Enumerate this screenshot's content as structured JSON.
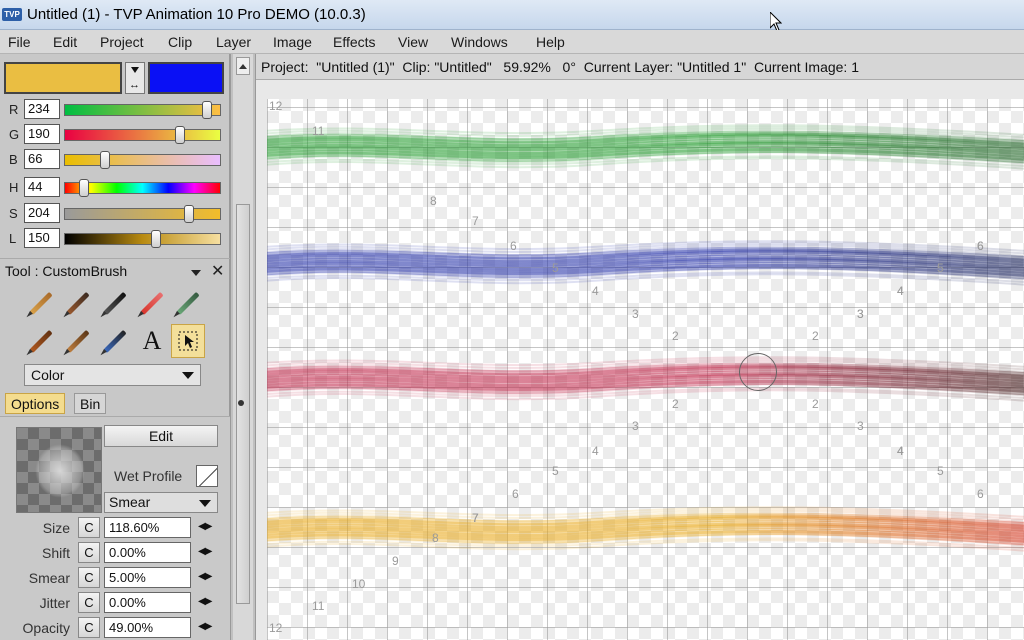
{
  "window": {
    "title": "Untitled (1) - TVP Animation 10 Pro DEMO (10.0.3)",
    "logo_text": "TVP"
  },
  "menu": [
    "File",
    "Edit",
    "Project",
    "Clip",
    "Layer",
    "Image",
    "Effects",
    "View",
    "Windows",
    "Help"
  ],
  "colors": {
    "primary": "#eabe42",
    "secondary": "#0a10f5"
  },
  "sliders": [
    {
      "label": "R",
      "value": "234",
      "fraction": 0.918
    },
    {
      "label": "G",
      "value": "190",
      "fraction": 0.745
    },
    {
      "label": "B",
      "value": "66",
      "fraction": 0.259
    },
    {
      "label": "H",
      "value": "44",
      "fraction": 0.122
    },
    {
      "label": "S",
      "value": "204",
      "fraction": 0.8
    },
    {
      "label": "L",
      "value": "150",
      "fraction": 0.588
    }
  ],
  "tool": {
    "title": "Tool : CustomBrush",
    "close": "✕",
    "icons": [
      "pencil-tool-icon",
      "ink-pen-tool-icon",
      "airbrush-tool-icon",
      "eraser-pen-tool-icon",
      "chalk-tool-icon",
      "paint-brush-tool-icon",
      "flat-brush-tool-icon",
      "knife-brush-tool-icon",
      "text-tool-icon",
      "custom-brush-select-tool-icon"
    ],
    "text_glyph": "A",
    "mode": "Color"
  },
  "tabs": [
    "Options",
    "Bin"
  ],
  "options": {
    "edit_label": "Edit",
    "wet_profile_label": "Wet Profile",
    "blend_mode": "Smear",
    "params": [
      {
        "label": "Size",
        "c": "C",
        "value": "118.60%"
      },
      {
        "label": "Shift",
        "c": "C",
        "value": "0.00%"
      },
      {
        "label": "Smear",
        "c": "C",
        "value": "5.00%"
      },
      {
        "label": "Jitter",
        "c": "C",
        "value": "0.00%"
      },
      {
        "label": "Opacity",
        "c": "C",
        "value": "49.00%"
      }
    ]
  },
  "status": {
    "text": "Project:  \"Untitled (1)\"  Clip: \"Untitled\"   59.92%   0°  Current Layer: \"Untitled 1\"  Current Image: 1"
  },
  "strokes": [
    {
      "color": "#1f9a2a",
      "dark": "#145c1a"
    },
    {
      "color": "#2430a8",
      "dark": "#101a55"
    },
    {
      "color": "#c0284a",
      "dark": "#3a1010"
    },
    {
      "color": "#e8a818",
      "dark": "#d0301a"
    }
  ],
  "grid_numbers": [
    "12",
    "11",
    "8",
    "7",
    "6",
    "5",
    "4",
    "3",
    "2",
    "2",
    "6",
    "5",
    "4",
    "3",
    "2",
    "2",
    "3",
    "4",
    "5",
    "6",
    "7",
    "4",
    "3",
    "4",
    "5",
    "6",
    "7",
    "8",
    "9",
    "10",
    "11",
    "12",
    "6",
    "5",
    "4",
    "3",
    "7"
  ]
}
